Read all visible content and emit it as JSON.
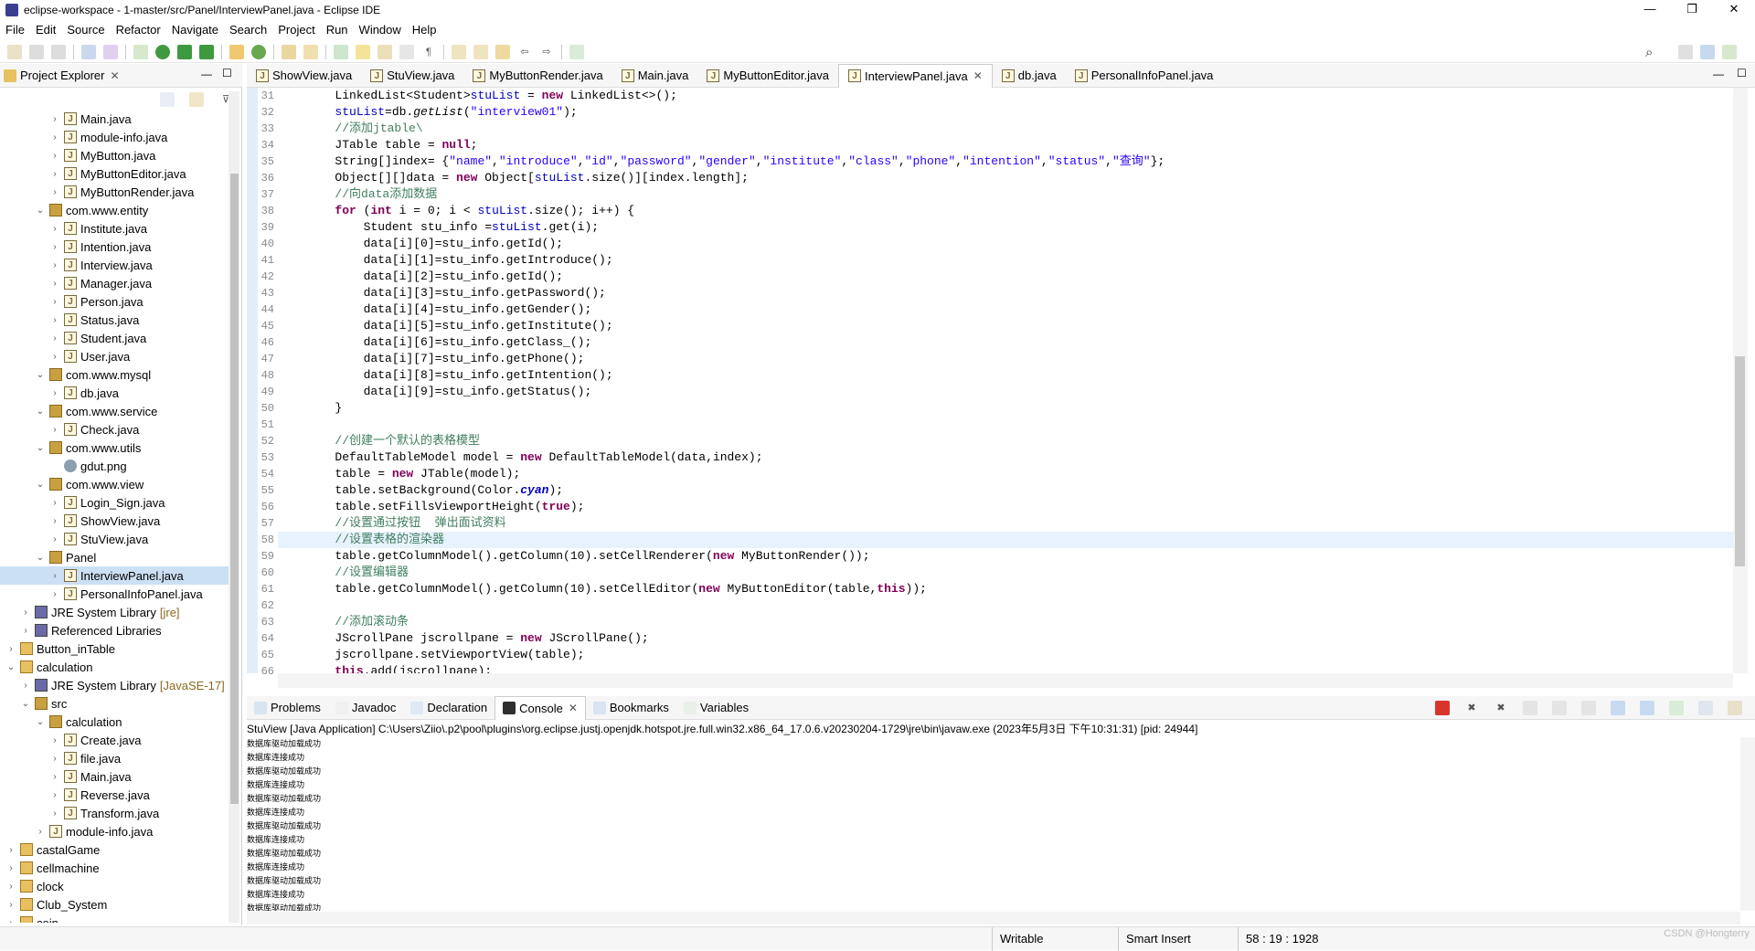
{
  "window": {
    "title": "eclipse-workspace - 1-master/src/Panel/InterviewPanel.java - Eclipse IDE",
    "controls": [
      "—",
      "❐",
      "✕"
    ]
  },
  "menu": [
    "File",
    "Edit",
    "Source",
    "Refactor",
    "Navigate",
    "Search",
    "Project",
    "Run",
    "Window",
    "Help"
  ],
  "project_explorer": {
    "title": "Project Explorer",
    "tree": [
      {
        "label": "Main.java",
        "indent": 3,
        "icon": "java",
        "exp": ">"
      },
      {
        "label": "module-info.java",
        "indent": 3,
        "icon": "java",
        "exp": ">"
      },
      {
        "label": "MyButton.java",
        "indent": 3,
        "icon": "java",
        "exp": ">"
      },
      {
        "label": "MyButtonEditor.java",
        "indent": 3,
        "icon": "java",
        "exp": ">"
      },
      {
        "label": "MyButtonRender.java",
        "indent": 3,
        "icon": "java",
        "exp": ">"
      },
      {
        "label": "com.www.entity",
        "indent": 2,
        "icon": "pkg",
        "exp": "v"
      },
      {
        "label": "Institute.java",
        "indent": 3,
        "icon": "java",
        "exp": ">"
      },
      {
        "label": "Intention.java",
        "indent": 3,
        "icon": "java",
        "exp": ">"
      },
      {
        "label": "Interview.java",
        "indent": 3,
        "icon": "java",
        "exp": ">"
      },
      {
        "label": "Manager.java",
        "indent": 3,
        "icon": "java",
        "exp": ">"
      },
      {
        "label": "Person.java",
        "indent": 3,
        "icon": "java",
        "exp": ">"
      },
      {
        "label": "Status.java",
        "indent": 3,
        "icon": "java",
        "exp": ">"
      },
      {
        "label": "Student.java",
        "indent": 3,
        "icon": "java",
        "exp": ">"
      },
      {
        "label": "User.java",
        "indent": 3,
        "icon": "java",
        "exp": ">"
      },
      {
        "label": "com.www.mysql",
        "indent": 2,
        "icon": "pkg",
        "exp": "v"
      },
      {
        "label": "db.java",
        "indent": 3,
        "icon": "java",
        "exp": ">"
      },
      {
        "label": "com.www.service",
        "indent": 2,
        "icon": "pkg",
        "exp": "v"
      },
      {
        "label": "Check.java",
        "indent": 3,
        "icon": "java",
        "exp": ">"
      },
      {
        "label": "com.www.utils",
        "indent": 2,
        "icon": "pkg",
        "exp": "v"
      },
      {
        "label": "gdut.png",
        "indent": 3,
        "icon": "img",
        "exp": ""
      },
      {
        "label": "com.www.view",
        "indent": 2,
        "icon": "pkg",
        "exp": "v"
      },
      {
        "label": "Login_Sign.java",
        "indent": 3,
        "icon": "java",
        "exp": ">"
      },
      {
        "label": "ShowView.java",
        "indent": 3,
        "icon": "java",
        "exp": ">"
      },
      {
        "label": "StuView.java",
        "indent": 3,
        "icon": "java",
        "exp": ">"
      },
      {
        "label": "Panel",
        "indent": 2,
        "icon": "pkg",
        "exp": "v"
      },
      {
        "label": "InterviewPanel.java",
        "indent": 3,
        "icon": "java",
        "exp": ">",
        "selected": true
      },
      {
        "label": "PersonalInfoPanel.java",
        "indent": 3,
        "icon": "java",
        "exp": ">"
      },
      {
        "label": "JRE System Library",
        "deco": "[jre]",
        "indent": 1,
        "icon": "lib",
        "exp": ">"
      },
      {
        "label": "Referenced Libraries",
        "indent": 1,
        "icon": "lib",
        "exp": ">"
      },
      {
        "label": "Button_inTable",
        "indent": 0,
        "icon": "proj",
        "exp": ">"
      },
      {
        "label": "calculation",
        "indent": 0,
        "icon": "proj",
        "exp": "v"
      },
      {
        "label": "JRE System Library",
        "deco": "[JavaSE-17]",
        "indent": 1,
        "icon": "lib",
        "exp": ">"
      },
      {
        "label": "src",
        "indent": 1,
        "icon": "src",
        "exp": "v"
      },
      {
        "label": "calculation",
        "indent": 2,
        "icon": "pkg",
        "exp": "v"
      },
      {
        "label": "Create.java",
        "indent": 3,
        "icon": "java",
        "exp": ">"
      },
      {
        "label": "file.java",
        "indent": 3,
        "icon": "java",
        "exp": ">"
      },
      {
        "label": "Main.java",
        "indent": 3,
        "icon": "java",
        "exp": ">"
      },
      {
        "label": "Reverse.java",
        "indent": 3,
        "icon": "java",
        "exp": ">"
      },
      {
        "label": "Transform.java",
        "indent": 3,
        "icon": "java",
        "exp": ">"
      },
      {
        "label": "module-info.java",
        "indent": 2,
        "icon": "java",
        "exp": ">"
      },
      {
        "label": "castalGame",
        "indent": 0,
        "icon": "proj",
        "exp": ">"
      },
      {
        "label": "cellmachine",
        "indent": 0,
        "icon": "proj",
        "exp": ">"
      },
      {
        "label": "clock",
        "indent": 0,
        "icon": "proj",
        "exp": ">"
      },
      {
        "label": "Club_System",
        "indent": 0,
        "icon": "proj",
        "exp": ">"
      },
      {
        "label": "coin",
        "indent": 0,
        "icon": "proj",
        "exp": ">"
      }
    ]
  },
  "editor": {
    "tabs": [
      {
        "label": "ShowView.java",
        "active": false
      },
      {
        "label": "StuView.java",
        "active": false
      },
      {
        "label": "MyButtonRender.java",
        "active": false
      },
      {
        "label": "Main.java",
        "active": false
      },
      {
        "label": "MyButtonEditor.java",
        "active": false
      },
      {
        "label": "InterviewPanel.java",
        "active": true
      },
      {
        "label": "db.java",
        "active": false
      },
      {
        "label": "PersonalInfoPanel.java",
        "active": false
      }
    ],
    "highlight_line": 58,
    "lines": [
      {
        "n": "31",
        "t": [
          [
            "        LinkedList<Student>",
            ""
          ],
          [
            "stuList",
            "fld"
          ],
          [
            " = ",
            ""
          ],
          [
            "new",
            "kw"
          ],
          [
            " LinkedList<>();",
            ""
          ]
        ]
      },
      {
        "n": "32",
        "t": [
          [
            "        ",
            ""
          ],
          [
            "stuList",
            "fld"
          ],
          [
            "=db.",
            ""
          ],
          [
            "getList",
            "mi"
          ],
          [
            "(",
            ""
          ],
          [
            "\"interview01\"",
            "str"
          ],
          [
            ");",
            ""
          ]
        ]
      },
      {
        "n": "33",
        "t": [
          [
            "        ",
            ""
          ],
          [
            "//添加jtable\\",
            "cm"
          ]
        ]
      },
      {
        "n": "34",
        "t": [
          [
            "        JTable table = ",
            ""
          ],
          [
            "null",
            "kw"
          ],
          [
            ";",
            ""
          ]
        ]
      },
      {
        "n": "35",
        "t": [
          [
            "        String[]index= {",
            ""
          ],
          [
            "\"name\"",
            "str"
          ],
          [
            ",",
            ""
          ],
          [
            "\"introduce\"",
            "str"
          ],
          [
            ",",
            ""
          ],
          [
            "\"id\"",
            "str"
          ],
          [
            ",",
            ""
          ],
          [
            "\"password\"",
            "str"
          ],
          [
            ",",
            ""
          ],
          [
            "\"gender\"",
            "str"
          ],
          [
            ",",
            ""
          ],
          [
            "\"institute\"",
            "str"
          ],
          [
            ",",
            ""
          ],
          [
            "\"class\"",
            "str"
          ],
          [
            ",",
            ""
          ],
          [
            "\"phone\"",
            "str"
          ],
          [
            ",",
            ""
          ],
          [
            "\"intention\"",
            "str"
          ],
          [
            ",",
            ""
          ],
          [
            "\"status\"",
            "str"
          ],
          [
            ",",
            ""
          ],
          [
            "\"查询\"",
            "str"
          ],
          [
            "};",
            ""
          ]
        ]
      },
      {
        "n": "36",
        "t": [
          [
            "        Object[][]data = ",
            ""
          ],
          [
            "new",
            "kw"
          ],
          [
            " Object[",
            ""
          ],
          [
            "stuList",
            "fld"
          ],
          [
            ".size()][index.length];",
            ""
          ]
        ]
      },
      {
        "n": "37",
        "t": [
          [
            "        ",
            ""
          ],
          [
            "//向data添加数据",
            "cm"
          ]
        ]
      },
      {
        "n": "38",
        "t": [
          [
            "        ",
            ""
          ],
          [
            "for",
            "kw"
          ],
          [
            " (",
            ""
          ],
          [
            "int",
            "kw"
          ],
          [
            " i = 0; i < ",
            ""
          ],
          [
            "stuList",
            "fld"
          ],
          [
            ".size(); i++) {",
            ""
          ]
        ]
      },
      {
        "n": "39",
        "t": [
          [
            "            Student stu_info =",
            ""
          ],
          [
            "stuList",
            "fld"
          ],
          [
            ".get(i);",
            ""
          ]
        ]
      },
      {
        "n": "40",
        "t": [
          [
            "            data[i][0]=stu_info.getId();",
            ""
          ]
        ]
      },
      {
        "n": "41",
        "t": [
          [
            "            data[i][1]=stu_info.getIntroduce();",
            ""
          ]
        ]
      },
      {
        "n": "42",
        "t": [
          [
            "            data[i][2]=stu_info.getId();",
            ""
          ]
        ]
      },
      {
        "n": "43",
        "t": [
          [
            "            data[i][3]=stu_info.getPassword();",
            ""
          ]
        ]
      },
      {
        "n": "44",
        "t": [
          [
            "            data[i][4]=stu_info.getGender();",
            ""
          ]
        ]
      },
      {
        "n": "45",
        "t": [
          [
            "            data[i][5]=stu_info.getInstitute();",
            ""
          ]
        ]
      },
      {
        "n": "46",
        "t": [
          [
            "            data[i][6]=stu_info.getClass_();",
            ""
          ]
        ]
      },
      {
        "n": "47",
        "t": [
          [
            "            data[i][7]=stu_info.getPhone();",
            ""
          ]
        ]
      },
      {
        "n": "48",
        "t": [
          [
            "            data[i][8]=stu_info.getIntention();",
            ""
          ]
        ]
      },
      {
        "n": "49",
        "t": [
          [
            "            data[i][9]=stu_info.getStatus();",
            ""
          ]
        ]
      },
      {
        "n": "50",
        "t": [
          [
            "        }",
            ""
          ]
        ]
      },
      {
        "n": "51",
        "t": [
          [
            "",
            ""
          ]
        ]
      },
      {
        "n": "52",
        "t": [
          [
            "        ",
            ""
          ],
          [
            "//创建一个默认的表格模型",
            "cm"
          ]
        ]
      },
      {
        "n": "53",
        "t": [
          [
            "        DefaultTableModel model = ",
            ""
          ],
          [
            "new",
            "kw"
          ],
          [
            " DefaultTableModel(data,index);",
            ""
          ]
        ]
      },
      {
        "n": "54",
        "t": [
          [
            "        table = ",
            ""
          ],
          [
            "new",
            "kw"
          ],
          [
            " JTable(model);",
            ""
          ]
        ]
      },
      {
        "n": "55",
        "t": [
          [
            "        table.setBackground(Color.",
            ""
          ],
          [
            "cyan",
            "fldi"
          ],
          [
            ");",
            ""
          ]
        ]
      },
      {
        "n": "56",
        "t": [
          [
            "        table.setFillsViewportHeight(",
            ""
          ],
          [
            "true",
            "kw"
          ],
          [
            ");",
            ""
          ]
        ]
      },
      {
        "n": "57",
        "t": [
          [
            "        ",
            ""
          ],
          [
            "//设置通过按钮  弹出面试资料",
            "cm"
          ]
        ]
      },
      {
        "n": "58",
        "t": [
          [
            "        ",
            ""
          ],
          [
            "//设置表格的渲染器",
            "cm"
          ]
        ]
      },
      {
        "n": "59",
        "t": [
          [
            "        table.getColumnModel().getColumn(10).setCellRenderer(",
            ""
          ],
          [
            "new",
            "kw"
          ],
          [
            " MyButtonRender());",
            ""
          ]
        ]
      },
      {
        "n": "60",
        "t": [
          [
            "        ",
            ""
          ],
          [
            "//设置编辑器",
            "cm"
          ]
        ]
      },
      {
        "n": "61",
        "t": [
          [
            "        table.getColumnModel().getColumn(10).setCellEditor(",
            ""
          ],
          [
            "new",
            "kw"
          ],
          [
            " MyButtonEditor(table,",
            ""
          ],
          [
            "this",
            "kw"
          ],
          [
            "));",
            ""
          ]
        ]
      },
      {
        "n": "62",
        "t": [
          [
            "",
            ""
          ]
        ]
      },
      {
        "n": "63",
        "t": [
          [
            "        ",
            ""
          ],
          [
            "//添加滚动条",
            "cm"
          ]
        ]
      },
      {
        "n": "64",
        "t": [
          [
            "        JScrollPane jscrollpane = ",
            ""
          ],
          [
            "new",
            "kw"
          ],
          [
            " JScrollPane();",
            ""
          ]
        ]
      },
      {
        "n": "65",
        "t": [
          [
            "        jscrollpane.setViewportView(table);",
            ""
          ]
        ]
      },
      {
        "n": "66",
        "t": [
          [
            "        ",
            ""
          ],
          [
            "this",
            "kw"
          ],
          [
            ".add(jscrollpane);",
            ""
          ]
        ]
      }
    ]
  },
  "console": {
    "tabs": [
      {
        "label": "Problems",
        "active": false
      },
      {
        "label": "Javadoc",
        "active": false
      },
      {
        "label": "Declaration",
        "active": false
      },
      {
        "label": "Console",
        "active": true
      },
      {
        "label": "Bookmarks",
        "active": false
      },
      {
        "label": "Variables",
        "active": false
      }
    ],
    "header": "StuView [Java Application] C:\\Users\\Ziio\\.p2\\pool\\plugins\\org.eclipse.justj.openjdk.hotspot.jre.full.win32.x86_64_17.0.6.v20230204-1729\\jre\\bin\\javaw.exe  (2023年5月3日 下午10:31:31) [pid: 24944]",
    "output": [
      "数据库驱动加载成功",
      "数据库连接成功",
      "数据库驱动加载成功",
      "数据库连接成功",
      "数据库驱动加载成功",
      "数据库连接成功",
      "数据库驱动加载成功",
      "数据库连接成功",
      "数据库驱动加载成功",
      "数据库连接成功",
      "数据库驱动加载成功",
      "数据库连接成功",
      "数据库驱动加载成功",
      "数据库连接成功",
      "数据库驱动加载成功",
      "数据库连接成功"
    ]
  },
  "status": {
    "writable": "Writable",
    "insert_mode": "Smart Insert",
    "position": "58 : 19 : 1928",
    "watermark": "CSDN @Hongterry"
  }
}
